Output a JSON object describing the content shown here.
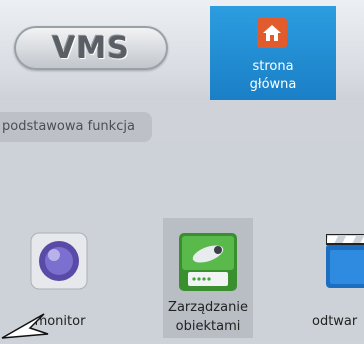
{
  "app": {
    "logo_text": "VMS"
  },
  "tabs": [
    {
      "label": "strona\ngłówna",
      "icon": "home-icon"
    }
  ],
  "section": {
    "title": "podstawowa funkcja"
  },
  "functions": [
    {
      "label": "monitor",
      "icon": "camera-lens-icon"
    },
    {
      "label": "Zarządzanie\nobiektami",
      "icon": "device-management-icon",
      "selected": true
    },
    {
      "label": "odtwar",
      "icon": "clapperboard-icon"
    }
  ],
  "colors": {
    "accent_tab": "#2190d6",
    "home_icon_bg": "#e25b2c"
  }
}
